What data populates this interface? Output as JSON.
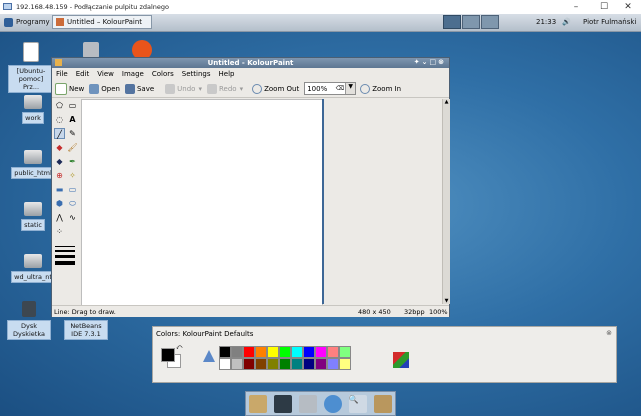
{
  "rdp": {
    "title": "192.168.48.159 - Podłączanie pulpitu zdalnego"
  },
  "taskbar": {
    "programs_label": "Programy",
    "active_task": "Untitled – KolourPaint",
    "clock": "21:33",
    "user": "Piotr Fulmański"
  },
  "desktop_icons": [
    {
      "label": "[Ubuntu-pomoc] Prz..."
    },
    {
      "label": "work"
    },
    {
      "label": "public_html"
    },
    {
      "label": "static"
    },
    {
      "label": "wd_ultra_nt"
    },
    {
      "label": "Dysk Dyskietka"
    },
    {
      "label": "NetBeans IDE 7.3.1"
    }
  ],
  "window": {
    "title": "Untitled - KolourPaint",
    "menu": [
      "File",
      "Edit",
      "View",
      "Image",
      "Colors",
      "Settings",
      "Help"
    ],
    "toolbar": {
      "new": "New",
      "open": "Open",
      "save": "Save",
      "undo": "Undo",
      "redo": "Redo",
      "zoom_out": "Zoom Out",
      "zoom_value": "100%",
      "zoom_in": "Zoom In"
    },
    "status": {
      "message": "Line: Drag to draw.",
      "size": "480 x 450",
      "bpp": "32bpp",
      "zoom": "100%"
    }
  },
  "colorbox": {
    "title": "Colors: KolourPaint Defaults",
    "palette_top": [
      "#000000",
      "#808080",
      "#ff0000",
      "#ff8000",
      "#ffff00",
      "#00ff00",
      "#00ffff",
      "#0000ff",
      "#ff00ff",
      "#ff8080",
      "#80ff80"
    ],
    "palette_bottom": [
      "#ffffff",
      "#c0c0c0",
      "#800000",
      "#804000",
      "#808000",
      "#008000",
      "#008080",
      "#000080",
      "#800080",
      "#8080ff",
      "#ffff80"
    ]
  }
}
